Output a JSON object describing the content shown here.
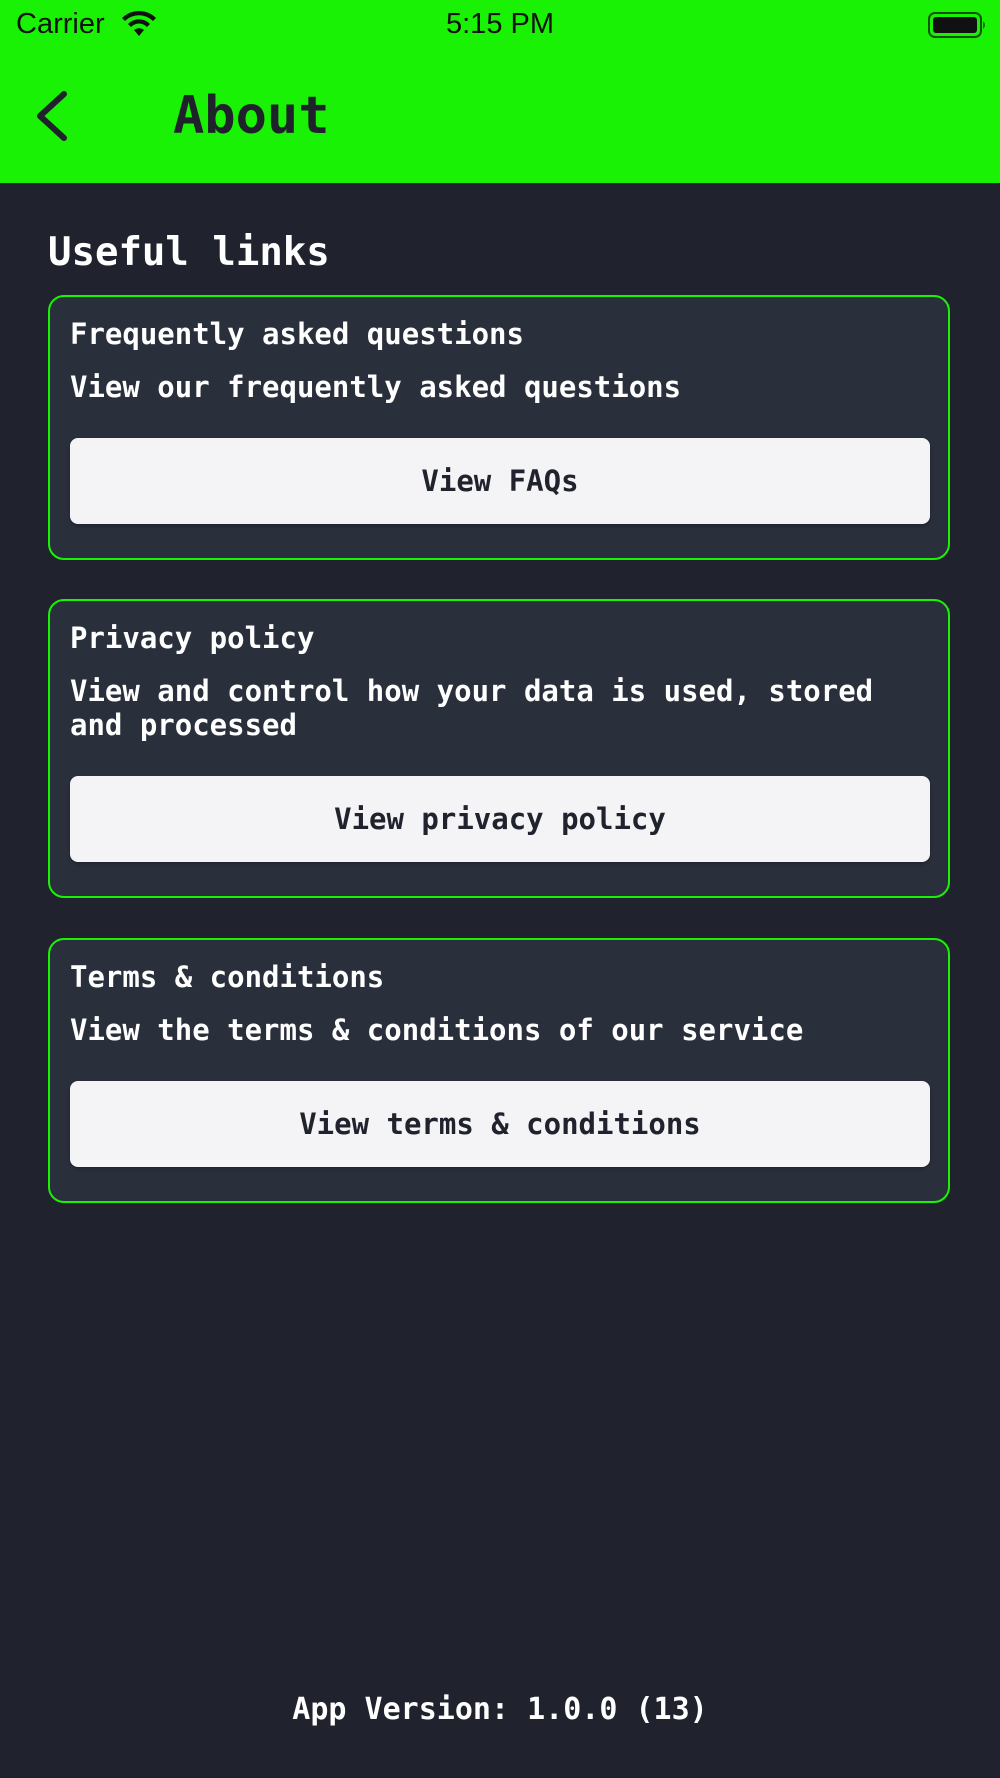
{
  "status_bar": {
    "carrier": "Carrier",
    "time": "5:15 PM",
    "icons": [
      "wifi-icon",
      "battery-icon"
    ]
  },
  "header": {
    "title": "About",
    "back_icon": "chevron-left-icon",
    "background_color": "#19f205"
  },
  "useful_links": {
    "title": "Useful links",
    "cards": [
      {
        "title": "Frequently asked questions",
        "description": "View our frequently asked questions",
        "button_label": "View FAQs"
      },
      {
        "title": "Privacy policy",
        "description": "View and control how your data is used, stored and processed",
        "button_label": "View privacy policy"
      },
      {
        "title": "Terms & conditions",
        "description": "View the terms & conditions of our service",
        "button_label": "View terms & conditions"
      }
    ]
  },
  "footer": {
    "app_version": "App Version: 1.0.0 (13)"
  },
  "colors": {
    "background": "#20232e",
    "card_background": "#2a2f3c",
    "accent": "#19f205",
    "button_background": "#f4f4f6"
  }
}
